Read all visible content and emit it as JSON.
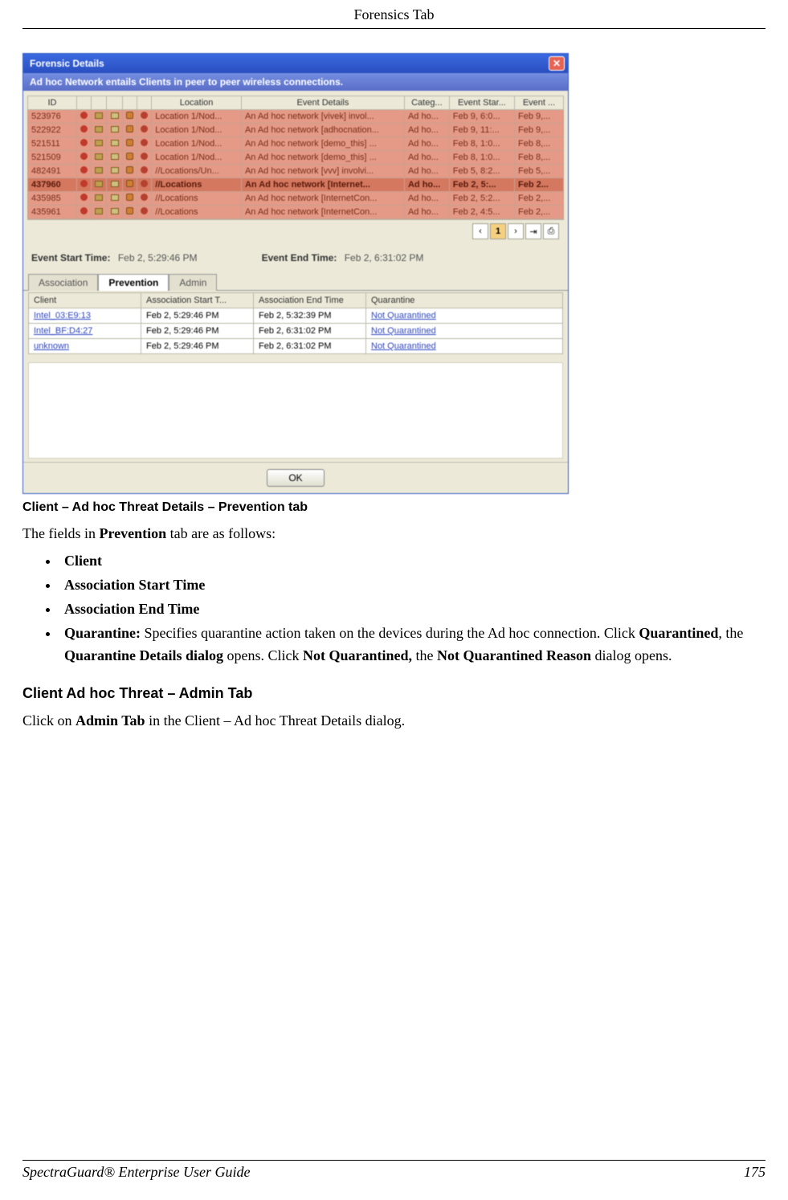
{
  "header": {
    "title": "Forensics Tab"
  },
  "dialog": {
    "title": "Forensic Details",
    "caption": "Ad hoc Network entails Clients in peer to peer wireless connections.",
    "columns": {
      "id": "ID",
      "location": "Location",
      "event_details": "Event Details",
      "category": "Categ...",
      "event_start": "Event Star...",
      "event_end": "Event ..."
    },
    "rows": [
      {
        "id": "523976",
        "location": "Location 1/Nod...",
        "details": "An Ad hoc network [vivek] invol...",
        "cat": "Ad ho...",
        "start": "Feb 9, 6:0...",
        "end": "Feb 9,..."
      },
      {
        "id": "522922",
        "location": "Location 1/Nod...",
        "details": "An Ad hoc network [adhocnation...",
        "cat": "Ad ho...",
        "start": "Feb 9, 11:...",
        "end": "Feb 9,..."
      },
      {
        "id": "521511",
        "location": "Location 1/Nod...",
        "details": "An Ad hoc network [demo_this] ...",
        "cat": "Ad ho...",
        "start": "Feb 8, 1:0...",
        "end": "Feb 8,..."
      },
      {
        "id": "521509",
        "location": "Location 1/Nod...",
        "details": "An Ad hoc network [demo_this] ...",
        "cat": "Ad ho...",
        "start": "Feb 8, 1:0...",
        "end": "Feb 8,..."
      },
      {
        "id": "482491",
        "location": "//Locations/Un...",
        "details": "An Ad hoc network [vvv] involvi...",
        "cat": "Ad ho...",
        "start": "Feb 5, 8:2...",
        "end": "Feb 5,..."
      },
      {
        "id": "437960",
        "location": "//Locations",
        "details": "An Ad hoc network [Internet...",
        "cat": "Ad ho...",
        "start": "Feb 2, 5:...",
        "end": "Feb 2...",
        "selected": true
      },
      {
        "id": "435985",
        "location": "//Locations",
        "details": "An Ad hoc network [InternetCon...",
        "cat": "Ad ho...",
        "start": "Feb 2, 5:2...",
        "end": "Feb 2,..."
      },
      {
        "id": "435961",
        "location": "//Locations",
        "details": "An Ad hoc network [InternetCon...",
        "cat": "Ad ho...",
        "start": "Feb 2, 4:5...",
        "end": "Feb 2,..."
      }
    ],
    "pager": {
      "prev": "|‹",
      "page": "1",
      "next": "›|",
      "jump": "Go",
      "print": "⎙"
    },
    "times": {
      "start_label": "Event Start Time:",
      "start_val": "Feb 2, 5:29:46 PM",
      "end_label": "Event End Time:",
      "end_val": "Feb 2, 6:31:02 PM"
    },
    "subtabs": {
      "assoc": "Association",
      "prev": "Prevention",
      "admin": "Admin"
    },
    "prev_table": {
      "cols": {
        "client": "Client",
        "astart": "Association Start T...",
        "aend": "Association End Time",
        "quar": "Quarantine"
      },
      "rows": [
        {
          "client": "Intel_03:E9:13",
          "astart": "Feb 2, 5:29:46 PM",
          "aend": "Feb 2, 5:32:39 PM",
          "quar": "Not Quarantined"
        },
        {
          "client": "Intel_BF:D4:27",
          "astart": "Feb 2, 5:29:46 PM",
          "aend": "Feb 2, 6:31:02 PM",
          "quar": "Not Quarantined"
        },
        {
          "client": "unknown",
          "astart": "Feb 2, 5:29:46 PM",
          "aend": "Feb 2, 6:31:02 PM",
          "quar": "Not Quarantined"
        }
      ]
    },
    "ok": "OK"
  },
  "caption_text": "Client – Ad hoc Threat Details – Prevention tab",
  "intro_a": "The fields in ",
  "intro_b": "Prevention",
  "intro_c": " tab are as follows:",
  "fields": {
    "client": "Client",
    "astart": "Association Start Time",
    "aend": "Association End Time",
    "quar_label": "Quarantine:",
    "quar_a": " Specifies quarantine action taken on the devices during the Ad hoc connection. Click ",
    "quar_b": "Quarantined",
    "quar_c": ", the ",
    "quar_d": "Quarantine Details dialog",
    "quar_e": " opens. Click ",
    "quar_f": "Not Quarantined,",
    "quar_g": " the ",
    "quar_h": "Not Quarantined Reason",
    "quar_i": " dialog opens."
  },
  "section2": {
    "heading": "Client Ad hoc Threat – Admin Tab",
    "body_a": "Click on ",
    "body_b": "Admin Tab",
    "body_c": " in the Client – Ad hoc Threat Details dialog."
  },
  "footer": {
    "left": "SpectraGuard® Enterprise User Guide",
    "right": "175"
  }
}
